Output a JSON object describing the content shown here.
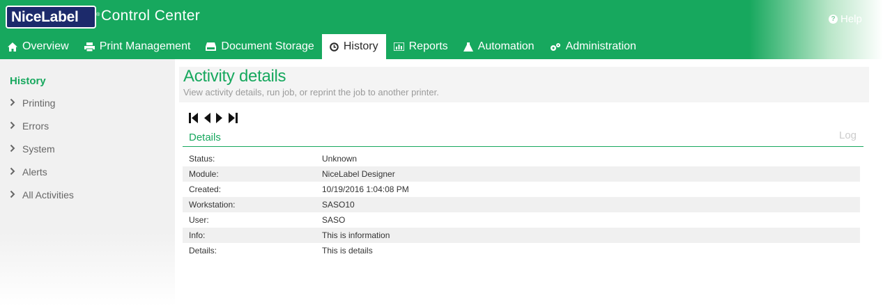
{
  "header": {
    "logo_text": "NiceLabel",
    "logo_mark": "®",
    "app_title": "Control Center",
    "help_label": "Help",
    "brand_color": "#17a85e"
  },
  "nav": {
    "tabs": [
      {
        "label": "Overview",
        "icon": "home-icon"
      },
      {
        "label": "Print Management",
        "icon": "printer-icon"
      },
      {
        "label": "Document Storage",
        "icon": "storage-icon"
      },
      {
        "label": "History",
        "icon": "clock-icon",
        "active": true
      },
      {
        "label": "Reports",
        "icon": "chart-icon"
      },
      {
        "label": "Automation",
        "icon": "automation-icon"
      },
      {
        "label": "Administration",
        "icon": "gears-icon"
      }
    ]
  },
  "sidebar": {
    "title": "History",
    "items": [
      {
        "label": "Printing"
      },
      {
        "label": "Errors"
      },
      {
        "label": "System"
      },
      {
        "label": "Alerts"
      },
      {
        "label": "All Activities"
      }
    ]
  },
  "main": {
    "title": "Activity details",
    "subtitle": "View activity details, run job, or reprint the job to another printer.",
    "pager": [
      "first-icon",
      "prev-icon",
      "next-icon",
      "last-icon"
    ],
    "section_title": "Details",
    "log_label": "Log",
    "details": [
      {
        "key": "Status:",
        "value": "Unknown"
      },
      {
        "key": "Module:",
        "value": "NiceLabel Designer"
      },
      {
        "key": "Created:",
        "value": "10/19/2016 1:04:08 PM"
      },
      {
        "key": "Workstation:",
        "value": "SASO10"
      },
      {
        "key": "User:",
        "value": "SASO"
      },
      {
        "key": "Info:",
        "value": "This is information"
      },
      {
        "key": "Details:",
        "value": "This is details"
      }
    ]
  }
}
